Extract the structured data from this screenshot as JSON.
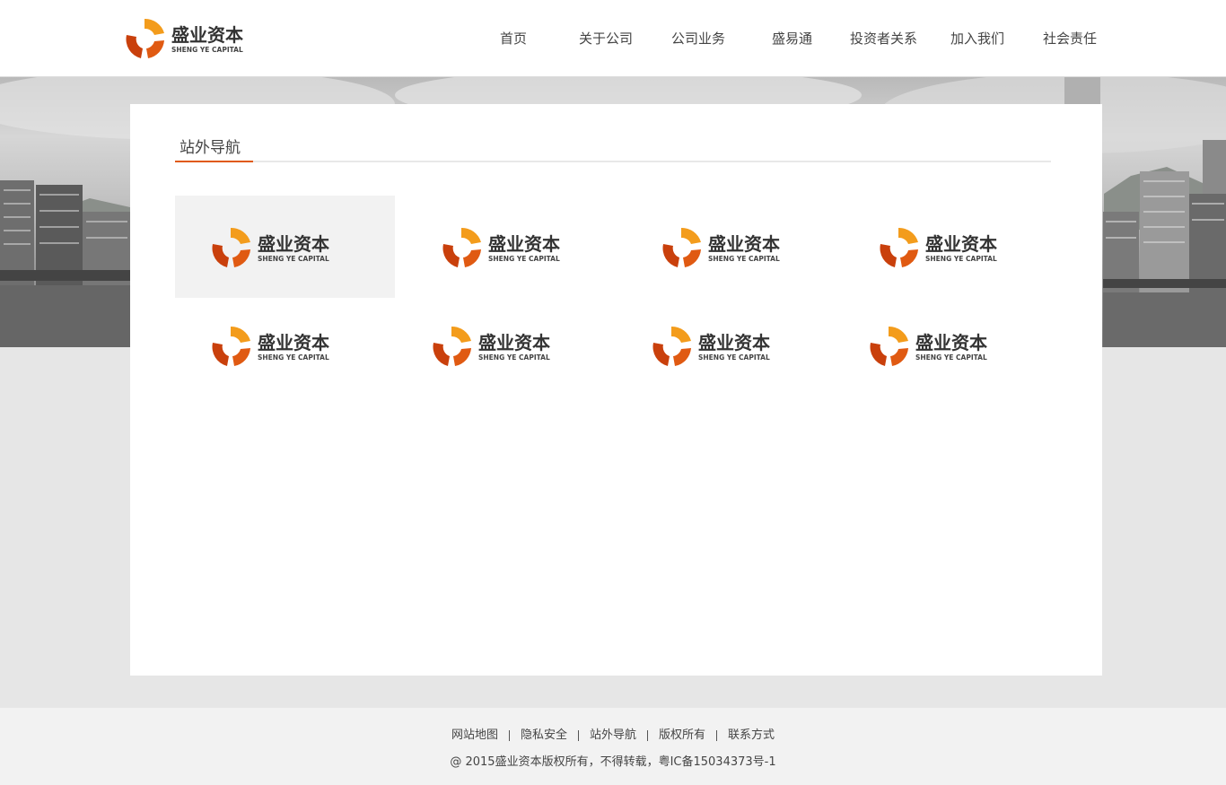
{
  "brand": {
    "name_cn": "盛业资本",
    "name_en": "SHENG YE CAPITAL",
    "accent_color": "#e05a12",
    "accent_color_2": "#f39c1c"
  },
  "nav": {
    "items": [
      {
        "label": "首页"
      },
      {
        "label": "关于公司"
      },
      {
        "label": "公司业务"
      },
      {
        "label": "盛易通"
      },
      {
        "label": "投资者关系"
      },
      {
        "label": "加入我们"
      },
      {
        "label": "社会责任"
      }
    ]
  },
  "main": {
    "section_title": "站外导航",
    "links": [
      {
        "logo": "sheng-ye-capital-logo",
        "active": true
      },
      {
        "logo": "sheng-ye-capital-logo",
        "active": false
      },
      {
        "logo": "sheng-ye-capital-logo",
        "active": false
      },
      {
        "logo": "sheng-ye-capital-logo",
        "active": false
      },
      {
        "logo": "sheng-ye-capital-logo",
        "active": false
      },
      {
        "logo": "sheng-ye-capital-logo",
        "active": false
      },
      {
        "logo": "sheng-ye-capital-logo",
        "active": false
      },
      {
        "logo": "sheng-ye-capital-logo",
        "active": false
      }
    ]
  },
  "footer": {
    "links": [
      {
        "label": "网站地图"
      },
      {
        "label": "隐私安全"
      },
      {
        "label": "站外导航"
      },
      {
        "label": "版权所有"
      },
      {
        "label": "联系方式"
      }
    ],
    "copyright": "@ 2015盛业资本版权所有，不得转载，粤IC备15034373号-1"
  }
}
